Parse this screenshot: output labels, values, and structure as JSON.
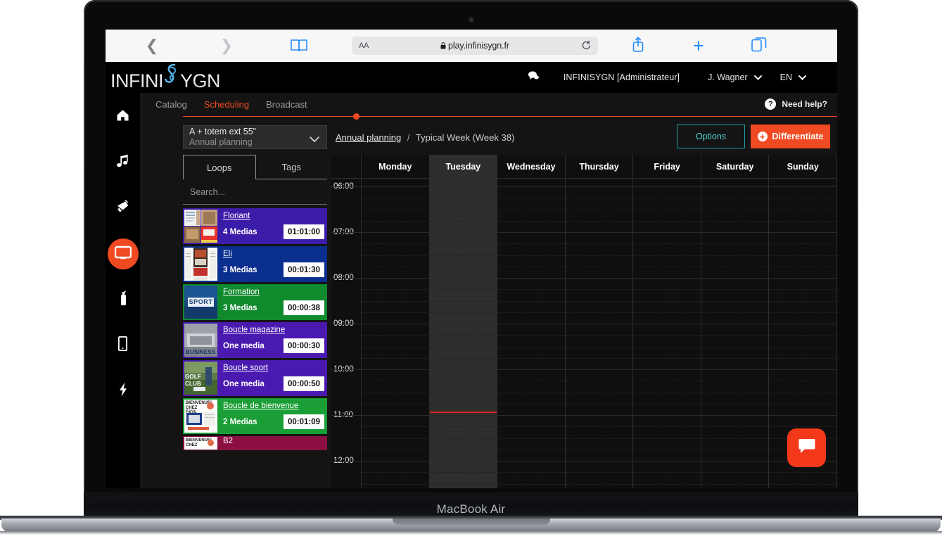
{
  "device": {
    "model_label": "MacBook Air"
  },
  "browser": {
    "back_icon": "chevron-left-icon",
    "forward_icon": "chevron-right-icon",
    "reader_icon": "book-icon",
    "aa_label": "AA",
    "url": "play.infinisygn.fr",
    "lock_icon": "lock-icon",
    "reload_icon": "reload-icon",
    "share_icon": "share-icon",
    "new_tab_icon": "plus-icon",
    "tabs_icon": "tabs-icon"
  },
  "header": {
    "logo_part1": "INFINI",
    "logo_part2": "YGN",
    "messages_icon": "chat-bubble-icon",
    "organization": "INFINISYGN [Administrateur]",
    "user": "J. Wagner",
    "user_caret": "chevron-down-icon",
    "language": "EN",
    "language_caret": "chevron-down-icon"
  },
  "rail": {
    "items": [
      {
        "name": "home",
        "icon": "home-icon",
        "active": false
      },
      {
        "name": "music",
        "icon": "music-note-icon",
        "active": false
      },
      {
        "name": "announce",
        "icon": "megaphone-icon",
        "active": false
      },
      {
        "name": "screens",
        "icon": "monitor-icon",
        "active": true
      },
      {
        "name": "diffuser",
        "icon": "spray-bottle-icon",
        "active": false
      },
      {
        "name": "mobile",
        "icon": "smartphone-icon",
        "active": false
      },
      {
        "name": "power",
        "icon": "lightning-bolt-icon",
        "active": false
      }
    ]
  },
  "tabs": {
    "items": [
      {
        "label": "Catalog",
        "active": false
      },
      {
        "label": "Scheduling",
        "active": true
      },
      {
        "label": "Broadcast",
        "active": false
      }
    ],
    "accent_color": "#f04a23"
  },
  "help": {
    "icon": "question-mark-icon",
    "label": "Need help?"
  },
  "toolbar": {
    "planning_select": {
      "value": "A + totem ext 55\"",
      "subtitle": "Annual planning",
      "caret_icon": "chevron-down-icon"
    },
    "breadcrumb": {
      "root": "Annual planning",
      "separator": "/",
      "current": "Typical Week (Week 38)"
    },
    "options_label": "Options",
    "options_color": "#4fd0d0",
    "differentiate_label": "Differentiate",
    "differentiate_icon": "plus-circle-icon",
    "differentiate_color": "#f04a23"
  },
  "loops_panel": {
    "tabs": [
      {
        "label": "Loops",
        "active": true
      },
      {
        "label": "Tags",
        "active": false
      }
    ],
    "search_placeholder": "Search...",
    "search_value": "",
    "items": [
      {
        "title": "Floriant",
        "count": "4 Medias",
        "duration": "01:01:00",
        "color": "#3b1ca8",
        "truncated": false
      },
      {
        "title": "Eli",
        "count": "3 Medias",
        "duration": "00:01:30",
        "color": "#0b2f8f",
        "truncated": false
      },
      {
        "title": "Formation",
        "count": "3 Medias",
        "duration": "00:00:38",
        "color": "#0f8a2d",
        "truncated": false
      },
      {
        "title": "Boucle magazine",
        "count": "One media",
        "duration": "00:00:30",
        "color": "#4a1ab0",
        "truncated": false
      },
      {
        "title": "Boucle sport",
        "count": "One media",
        "duration": "00:00:50",
        "color": "#4a1ab0",
        "truncated": false
      },
      {
        "title": "Boucle de bienvenue",
        "count": "2 Medias",
        "duration": "00:01:09",
        "color": "#1a9e35",
        "truncated": false
      },
      {
        "title": "B2",
        "count": "",
        "duration": "",
        "color": "#8c0f42",
        "truncated": true
      }
    ]
  },
  "calendar": {
    "days": [
      "Monday",
      "Tuesday",
      "Wednesday",
      "Thursday",
      "Friday",
      "Saturday",
      "Sunday"
    ],
    "highlighted_day": "Tuesday",
    "time_labels": [
      "06:00",
      "07:00",
      "08:00",
      "09:00",
      "10:00",
      "11:00",
      "12:00"
    ],
    "current_time_color": "#e02020"
  },
  "fab": {
    "icon": "chat-bubble-filled-icon",
    "color": "#f4391b"
  }
}
